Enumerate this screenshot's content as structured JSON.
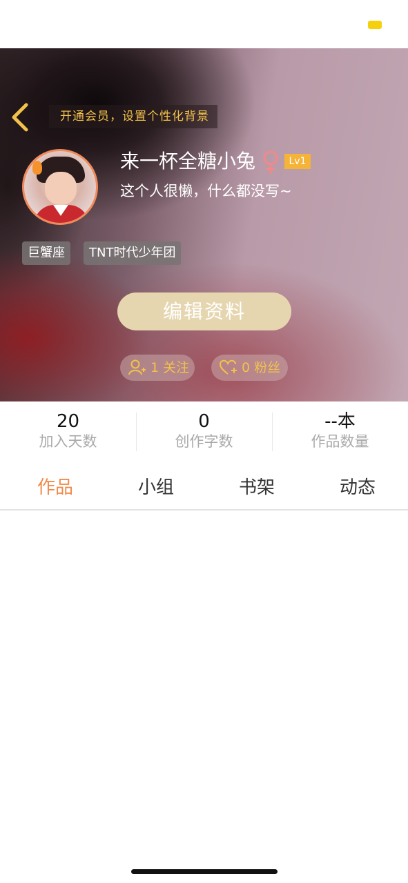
{
  "colors": {
    "accent": "#f08a4a",
    "gold_text": "#f2c24b",
    "level_badge": "#f5b338",
    "edit_button_bg": "#e6d6b0",
    "battery": "#f5d10d"
  },
  "status_bar": {
    "battery_icon": "battery-icon"
  },
  "header": {
    "back_icon": "chevron-left-icon",
    "vip_banner": "开通会员，设置个性化背景"
  },
  "profile": {
    "username": "来一杯全糖小兔",
    "gender_icon": "female-icon",
    "level": "Lv1",
    "bio": "这个人很懒，什么都没写~",
    "tags": [
      "巨蟹座",
      "TNT时代少年团"
    ],
    "edit_button": "编辑资料",
    "follow": "1 关注",
    "fans": "0 粉丝"
  },
  "stats": [
    {
      "value": "20",
      "label": "加入天数"
    },
    {
      "value": "0",
      "label": "创作字数"
    },
    {
      "value": "--本",
      "label": "作品数量"
    }
  ],
  "tabs": [
    "作品",
    "小组",
    "书架",
    "动态"
  ],
  "active_tab": "作品"
}
